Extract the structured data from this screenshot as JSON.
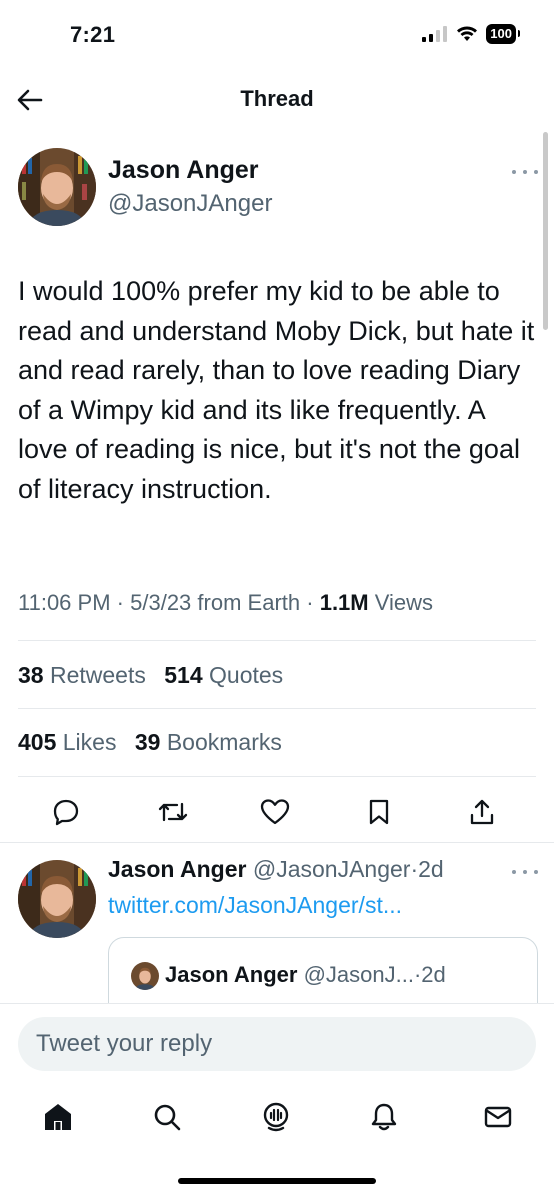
{
  "status": {
    "time": "7:21",
    "battery": "100"
  },
  "nav": {
    "title": "Thread"
  },
  "tweet": {
    "author_name": "Jason Anger",
    "author_handle": "@JasonJAnger",
    "text": "I would 100% prefer my kid to be able to read and understand Moby Dick, but hate it and read rarely, than to love reading Diary of a Wimpy kid and its like frequently. A love of reading is nice, but it's not the goal of literacy instruction.",
    "time": "11:06 PM",
    "date": "5/3/23",
    "source": "from Earth",
    "views_count": "1.1M",
    "views_label": "Views",
    "retweets_count": "38",
    "retweets_label": "Retweets",
    "quotes_count": "514",
    "quotes_label": "Quotes",
    "likes_count": "405",
    "likes_label": "Likes",
    "bookmarks_count": "39",
    "bookmarks_label": "Bookmarks"
  },
  "reply": {
    "author_name": "Jason Anger",
    "author_handle": "@JasonJAnger",
    "age": "2d",
    "link": "twitter.com/JasonJAnger/st...",
    "quote_author_name": "Jason Anger",
    "quote_author_handle": "@JasonJ...",
    "quote_age": "2d"
  },
  "compose": {
    "placeholder": "Tweet your reply"
  },
  "icons": {
    "back": "back-arrow-icon",
    "more": "more-icon",
    "reply": "reply-icon",
    "retweet": "retweet-icon",
    "like": "heart-icon",
    "bookmark": "bookmark-icon",
    "share": "share-icon",
    "home": "home-icon",
    "search": "search-icon",
    "spaces": "spaces-icon",
    "notifications": "bell-icon",
    "messages": "mail-icon"
  },
  "colors": {
    "link": "#1d9bf0",
    "text": "#0f1419",
    "muted": "#536471"
  }
}
